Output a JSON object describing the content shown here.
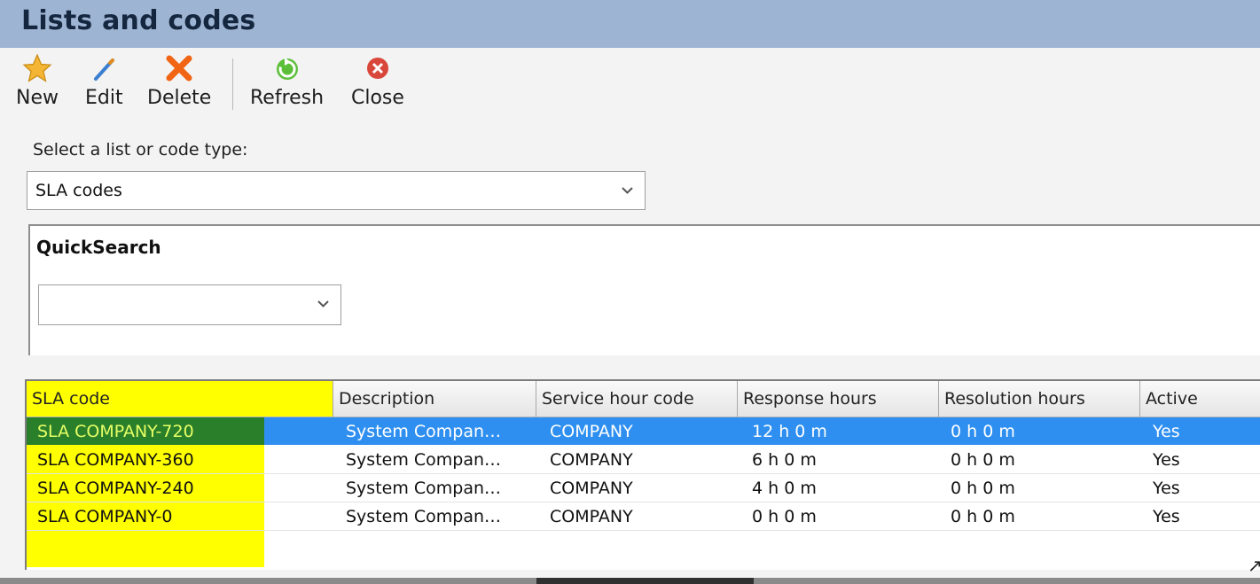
{
  "window": {
    "title": "Lists and codes"
  },
  "toolbar": {
    "buttons": [
      {
        "label": "New",
        "icon": "star-icon"
      },
      {
        "label": "Edit",
        "icon": "pencil-icon"
      },
      {
        "label": "Delete",
        "icon": "delete-x-icon"
      },
      {
        "label": "Refresh",
        "icon": "refresh-icon"
      },
      {
        "label": "Close",
        "icon": "close-circle-icon"
      }
    ]
  },
  "selector": {
    "label": "Select a list or code type:",
    "value": "SLA codes"
  },
  "quicksearch": {
    "title": "QuickSearch",
    "value": ""
  },
  "grid": {
    "columns": [
      "SLA code",
      "Description",
      "Service hour code",
      "Response hours",
      "Resolution hours",
      "Active"
    ],
    "rows": [
      [
        "SLA COMPANY-720",
        "System Compan…",
        "COMPANY",
        "12 h 0 m",
        "0 h 0 m",
        "Yes"
      ],
      [
        "SLA COMPANY-360",
        "System Compan…",
        "COMPANY",
        "6 h 0 m",
        "0 h 0 m",
        "Yes"
      ],
      [
        "SLA COMPANY-240",
        "System Compan…",
        "COMPANY",
        "4 h 0 m",
        "0 h 0 m",
        "Yes"
      ],
      [
        "SLA COMPANY-0",
        "System Compan…",
        "COMPANY",
        "0 h 0 m",
        "0 h 0 m",
        "Yes"
      ]
    ],
    "selected_row": 0
  },
  "colors": {
    "title_bar": "#9db4d3",
    "highlight": "#ffff00",
    "selection": "#2e8ff0"
  }
}
